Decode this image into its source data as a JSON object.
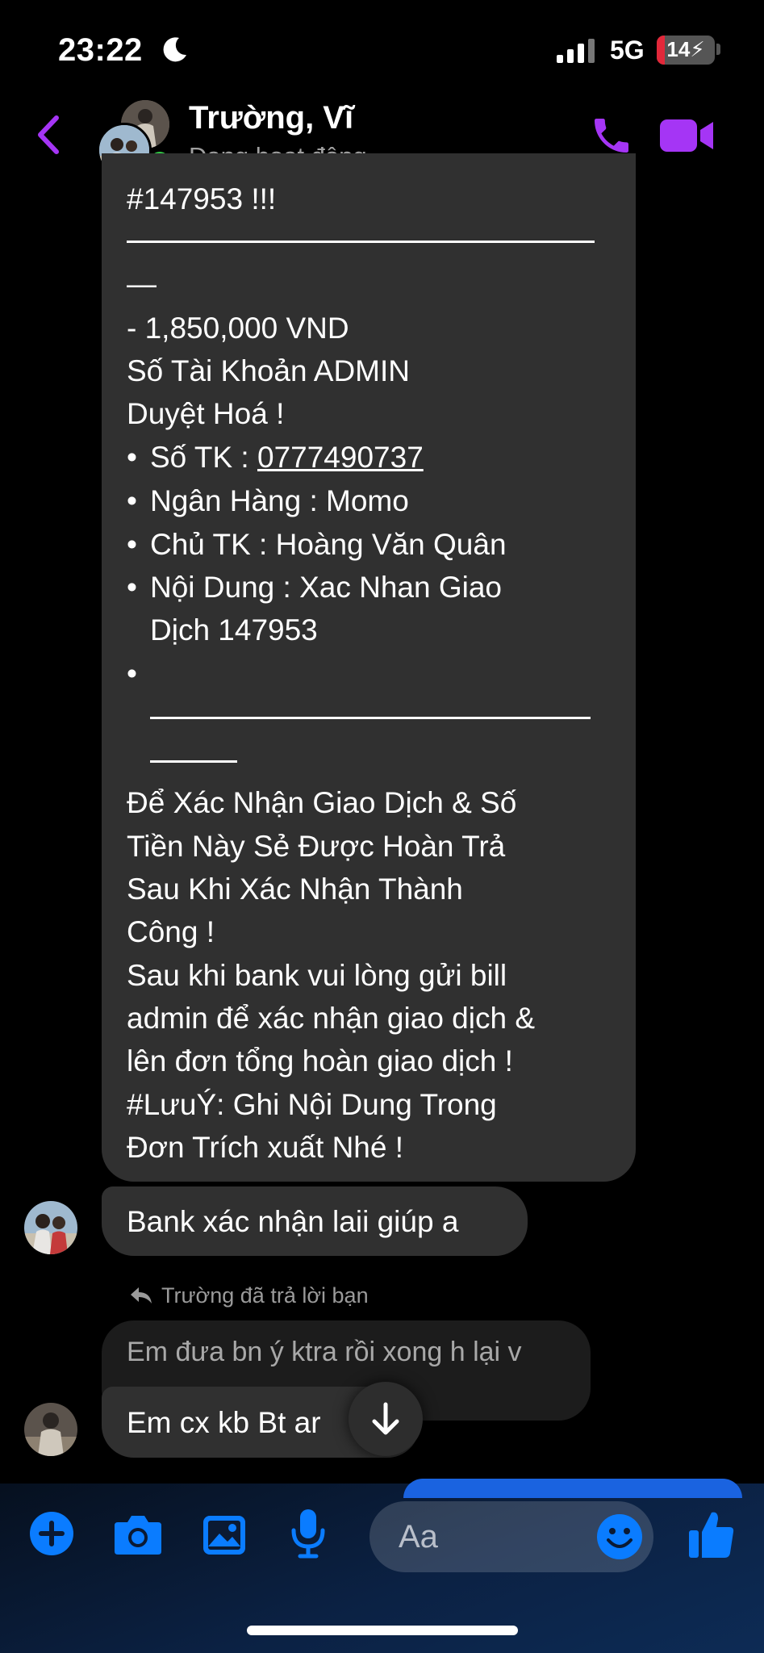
{
  "status_bar": {
    "time": "23:22",
    "network": "5G",
    "battery_percent": 14,
    "battery_label": "14",
    "focus_icon": "moon-icon",
    "signal_icon": "cellular-signal-icon"
  },
  "header": {
    "contact_name": "Trường, Vĩ",
    "presence": "Đang hoạt động",
    "icons": [
      "back-chevron-icon",
      "phone-icon",
      "video-camera-icon"
    ]
  },
  "thread": {
    "long_message_lines": [
      "#147953 !!!",
      "—",
      " - 1,850,000 VND",
      "Số Tài Khoản ADMIN",
      "Duyệt Hoá !",
      "Số TK : ",
      "0777490737",
      "Ngân Hàng : Momo",
      "Chủ TK : Hoàng Văn Quân",
      "Nội Dung : Xac Nhan Giao",
      "Dịch 147953",
      "Để Xác Nhận Giao Dịch & Số",
      "Tiền Này Sẻ Được Hoàn Trả",
      "Sau Khi Xác Nhận Thành",
      "Công !",
      "Sau khi bank vui lòng gửi bill",
      "admin để xác nhận giao dịch &",
      "lên đơn tổng hoàn giao dịch !",
      "#LưuÝ: Ghi Nội Dung Trong",
      "Đơn Trích xuất Nhé !"
    ],
    "bullet": "•",
    "msg_bank_confirm": "Bank xác nhận laii giúp a",
    "reply_label": "Trường đã trả lời bạn",
    "quoted_message": "Em đưa bn ý ktra rồi xong h lại v",
    "last_message": "Em cx kb Bt ar"
  },
  "composer": {
    "placeholder": "Aa",
    "icons": [
      "plus-icon",
      "camera-icon",
      "image-icon",
      "microphone-icon",
      "emoji-icon",
      "thumbs-up-icon"
    ]
  },
  "colors": {
    "accent_purple": "#a535f5",
    "messenger_blue": "#0a7cff",
    "bubble_gray": "#303030",
    "online_green": "#31cc46"
  }
}
